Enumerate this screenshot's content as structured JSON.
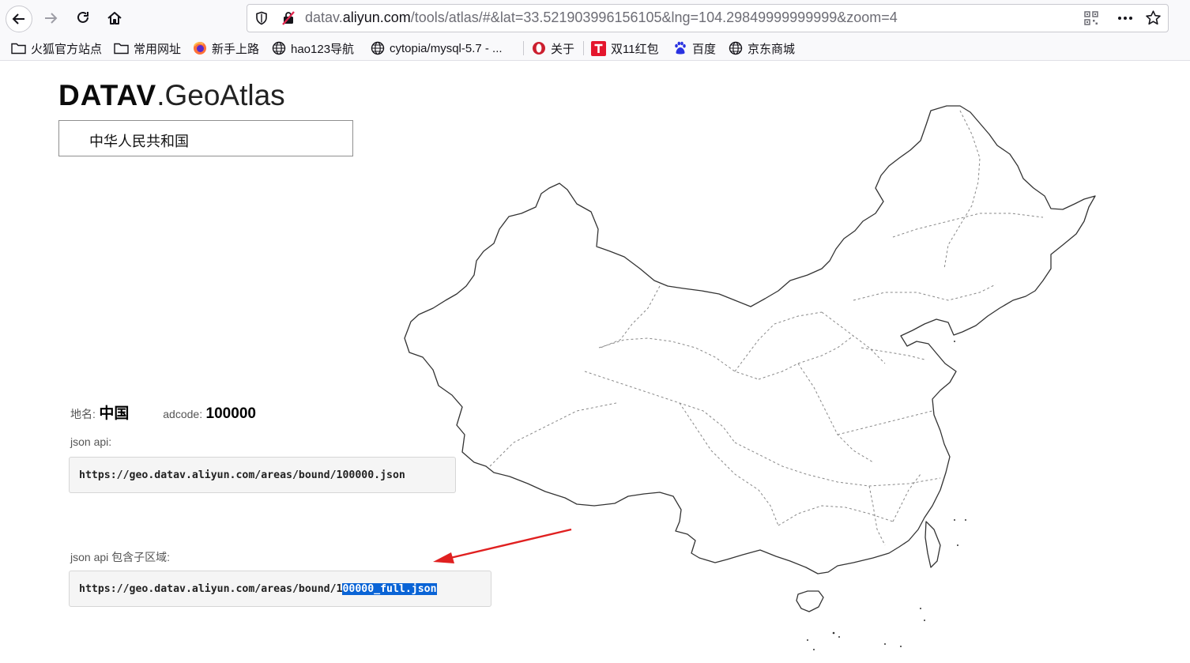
{
  "browser": {
    "url_prefix": "datav.",
    "url_host": "aliyun.com",
    "url_path": "/tools/atlas/#&lat=33.521903996156105&lng=104.29849999999999&zoom=4",
    "icons": [
      "back-icon",
      "forward-icon",
      "reload-icon",
      "home-icon",
      "shield-icon",
      "tracking-blocked-icon",
      "qr-code-icon",
      "more-icon",
      "star-icon"
    ],
    "bookmarks": [
      {
        "label": "火狐官方站点",
        "icon": "folder-icon"
      },
      {
        "label": "常用网址",
        "icon": "folder-icon"
      },
      {
        "label": "新手上路",
        "icon": "firefox-icon"
      },
      {
        "label": "hao123导航",
        "icon": "globe-icon"
      },
      {
        "label": "cytopia/mysql-5.7 - ...",
        "icon": "globe-icon"
      },
      {
        "label": "关于",
        "icon": "opera-icon"
      },
      {
        "label": "双11红包",
        "icon": "tmall-icon"
      },
      {
        "label": "百度",
        "icon": "baidu-icon"
      },
      {
        "label": "京东商城",
        "icon": "globe-icon"
      }
    ]
  },
  "page": {
    "logo_bold": "DATAV",
    "logo_light": ".GeoAtlas",
    "region_select_value": "中华人民共和国",
    "place_label": "地名:",
    "place_name": "中国",
    "adcode_label": "adcode:",
    "adcode_value": "100000",
    "api_label": "json api:",
    "api_url": "https://geo.datav.aliyun.com/areas/bound/100000.json",
    "api_full_label": "json api 包含子区域:",
    "api_full_prefix": "https://geo.datav.aliyun.com/areas/bound/1",
    "api_full_selected": "00000_full.json",
    "annotation_color": "#e02020",
    "selection_color": "#0a64d6"
  }
}
